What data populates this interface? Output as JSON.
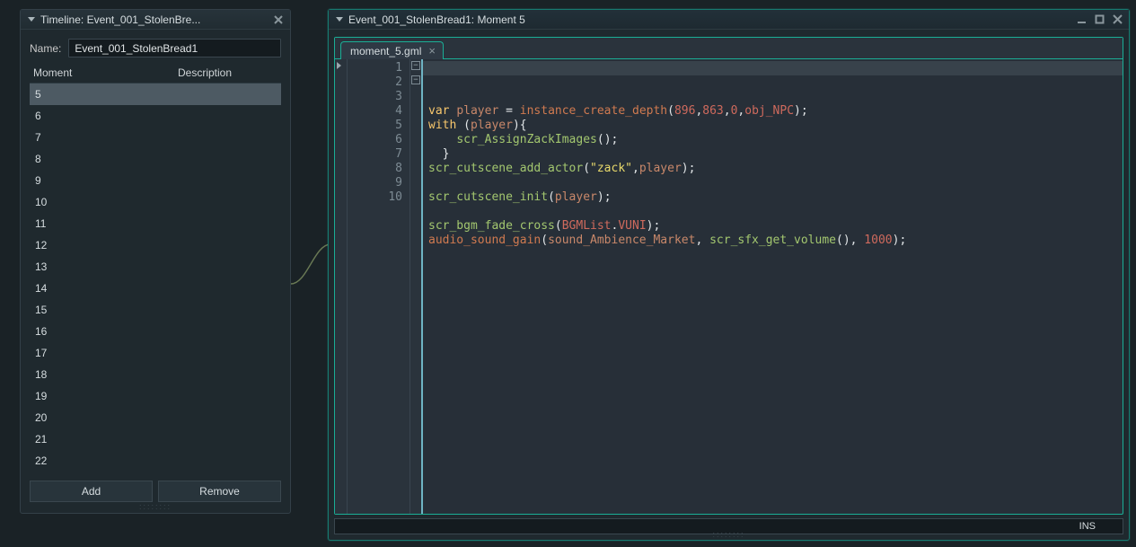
{
  "timeline_panel": {
    "title": "Timeline: Event_001_StolenBre...",
    "name_label": "Name:",
    "name_value": "Event_001_StolenBread1",
    "columns": {
      "moment": "Moment",
      "description": "Description"
    },
    "moments": [
      "5",
      "6",
      "7",
      "8",
      "9",
      "10",
      "11",
      "12",
      "13",
      "14",
      "15",
      "16",
      "17",
      "18",
      "19",
      "20",
      "21",
      "22"
    ],
    "selected_index": 0,
    "add_label": "Add",
    "remove_label": "Remove"
  },
  "code_panel": {
    "title": "Event_001_StolenBread1: Moment 5",
    "tab_label": "moment_5.gml",
    "status_mode": "INS",
    "line_numbers": [
      "1",
      "2",
      "3",
      "4",
      "5",
      "6",
      "7",
      "8",
      "9",
      "10"
    ],
    "code_tokens": [
      [
        [
          "kw",
          "var"
        ],
        [
          "txt",
          " "
        ],
        [
          "id",
          "player"
        ],
        [
          "txt",
          " = "
        ],
        [
          "fn",
          "instance_create_depth"
        ],
        [
          "par",
          "("
        ],
        [
          "num",
          "896"
        ],
        [
          "txt",
          ","
        ],
        [
          "num",
          "863"
        ],
        [
          "txt",
          ","
        ],
        [
          "num",
          "0"
        ],
        [
          "txt",
          ","
        ],
        [
          "obj",
          "obj_NPC"
        ],
        [
          "par",
          ")"
        ],
        [
          "txt",
          ";"
        ]
      ],
      [
        [
          "kw",
          "with"
        ],
        [
          "txt",
          " "
        ],
        [
          "par",
          "("
        ],
        [
          "id",
          "player"
        ],
        [
          "par",
          ")"
        ],
        [
          "txt",
          "{"
        ]
      ],
      [
        [
          "txt",
          "    "
        ],
        [
          "sc",
          "scr_AssignZackImages"
        ],
        [
          "par",
          "("
        ],
        [
          "par",
          ")"
        ],
        [
          "txt",
          ";"
        ]
      ],
      [
        [
          "txt",
          "  "
        ],
        [
          "txt",
          "}"
        ]
      ],
      [
        [
          "sc",
          "scr_cutscene_add_actor"
        ],
        [
          "par",
          "("
        ],
        [
          "str",
          "\"zack\""
        ],
        [
          "txt",
          ","
        ],
        [
          "id",
          "player"
        ],
        [
          "par",
          ")"
        ],
        [
          "txt",
          ";"
        ]
      ],
      [],
      [
        [
          "sc",
          "scr_cutscene_init"
        ],
        [
          "par",
          "("
        ],
        [
          "id",
          "player"
        ],
        [
          "par",
          ")"
        ],
        [
          "txt",
          ";"
        ]
      ],
      [],
      [
        [
          "sc",
          "scr_bgm_fade_cross"
        ],
        [
          "par",
          "("
        ],
        [
          "enm",
          "BGMList"
        ],
        [
          "txt",
          "."
        ],
        [
          "enm",
          "VUNI"
        ],
        [
          "par",
          ")"
        ],
        [
          "txt",
          ";"
        ]
      ],
      [
        [
          "fn",
          "audio_sound_gain"
        ],
        [
          "par",
          "("
        ],
        [
          "id",
          "sound_Ambience_Market"
        ],
        [
          "txt",
          ", "
        ],
        [
          "sc",
          "scr_sfx_get_volume"
        ],
        [
          "par",
          "("
        ],
        [
          "par",
          ")"
        ],
        [
          "txt",
          ", "
        ],
        [
          "num",
          "1000"
        ],
        [
          "par",
          ")"
        ],
        [
          "txt",
          ";"
        ]
      ]
    ]
  }
}
